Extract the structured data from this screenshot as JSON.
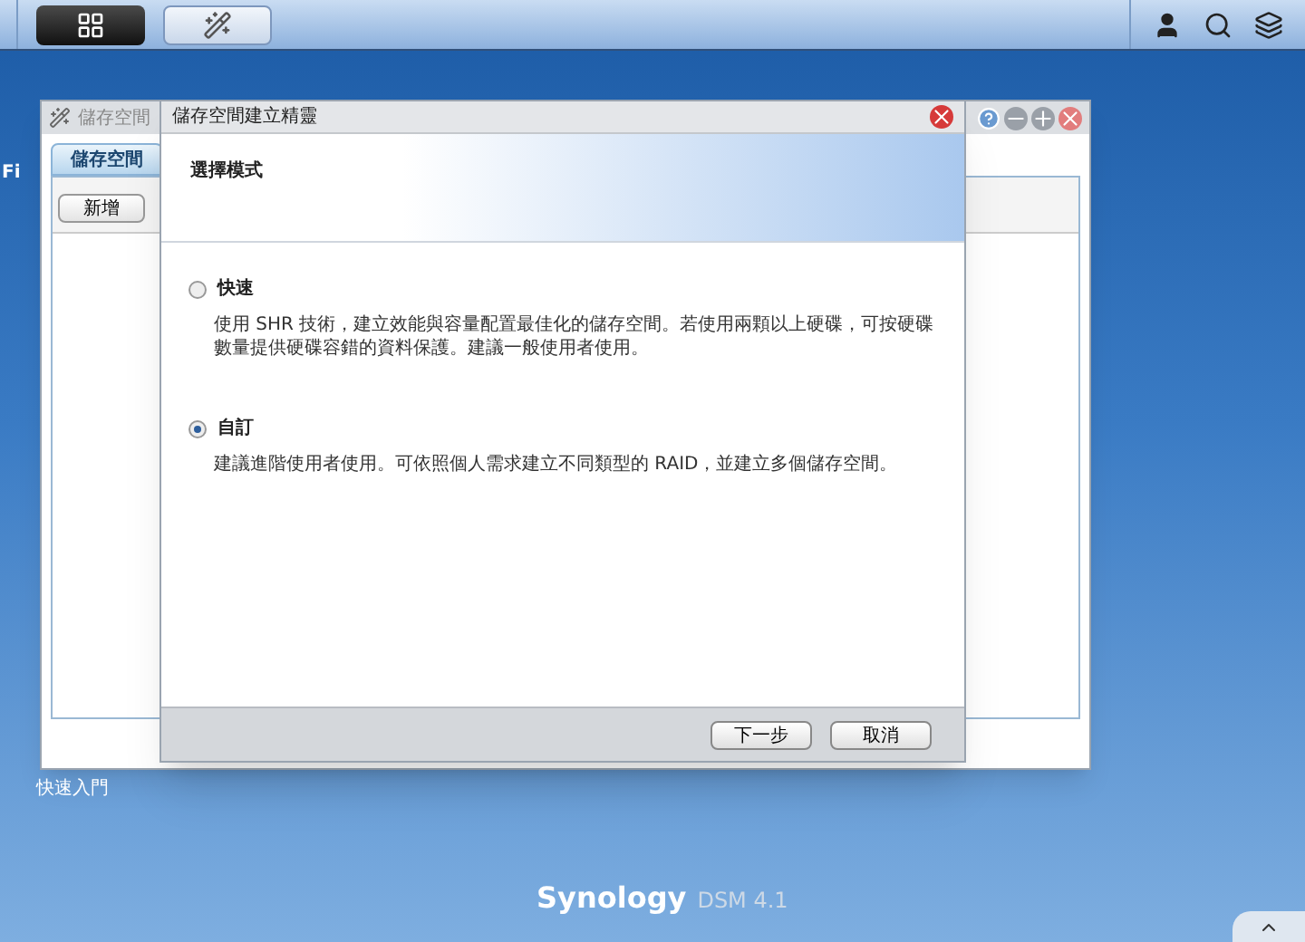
{
  "taskbar": {
    "apps": [
      {
        "selected": true
      },
      {
        "selected": false
      }
    ]
  },
  "desktop": {
    "icon_label": "Fi",
    "shortcut_label": "快速入門",
    "brand": "Synology",
    "brand_version": "DSM 4.1"
  },
  "background_window": {
    "title": "儲存空間",
    "tab": "儲存空間",
    "button": "新增"
  },
  "wizard": {
    "title": "儲存空間建立精靈",
    "step_title": "選擇模式",
    "options": [
      {
        "label": "快速",
        "description": "使用 SHR 技術，建立效能與容量配置最佳化的儲存空間。若使用兩顆以上硬碟，可按硬碟數量提供硬碟容錯的資料保護。建議一般使用者使用。",
        "selected": false
      },
      {
        "label": "自訂",
        "description": "建議進階使用者使用。可依照個人需求建立不同類型的 RAID，並建立多個儲存空間。",
        "selected": true
      }
    ],
    "buttons": [
      "下一步",
      "取消"
    ]
  }
}
